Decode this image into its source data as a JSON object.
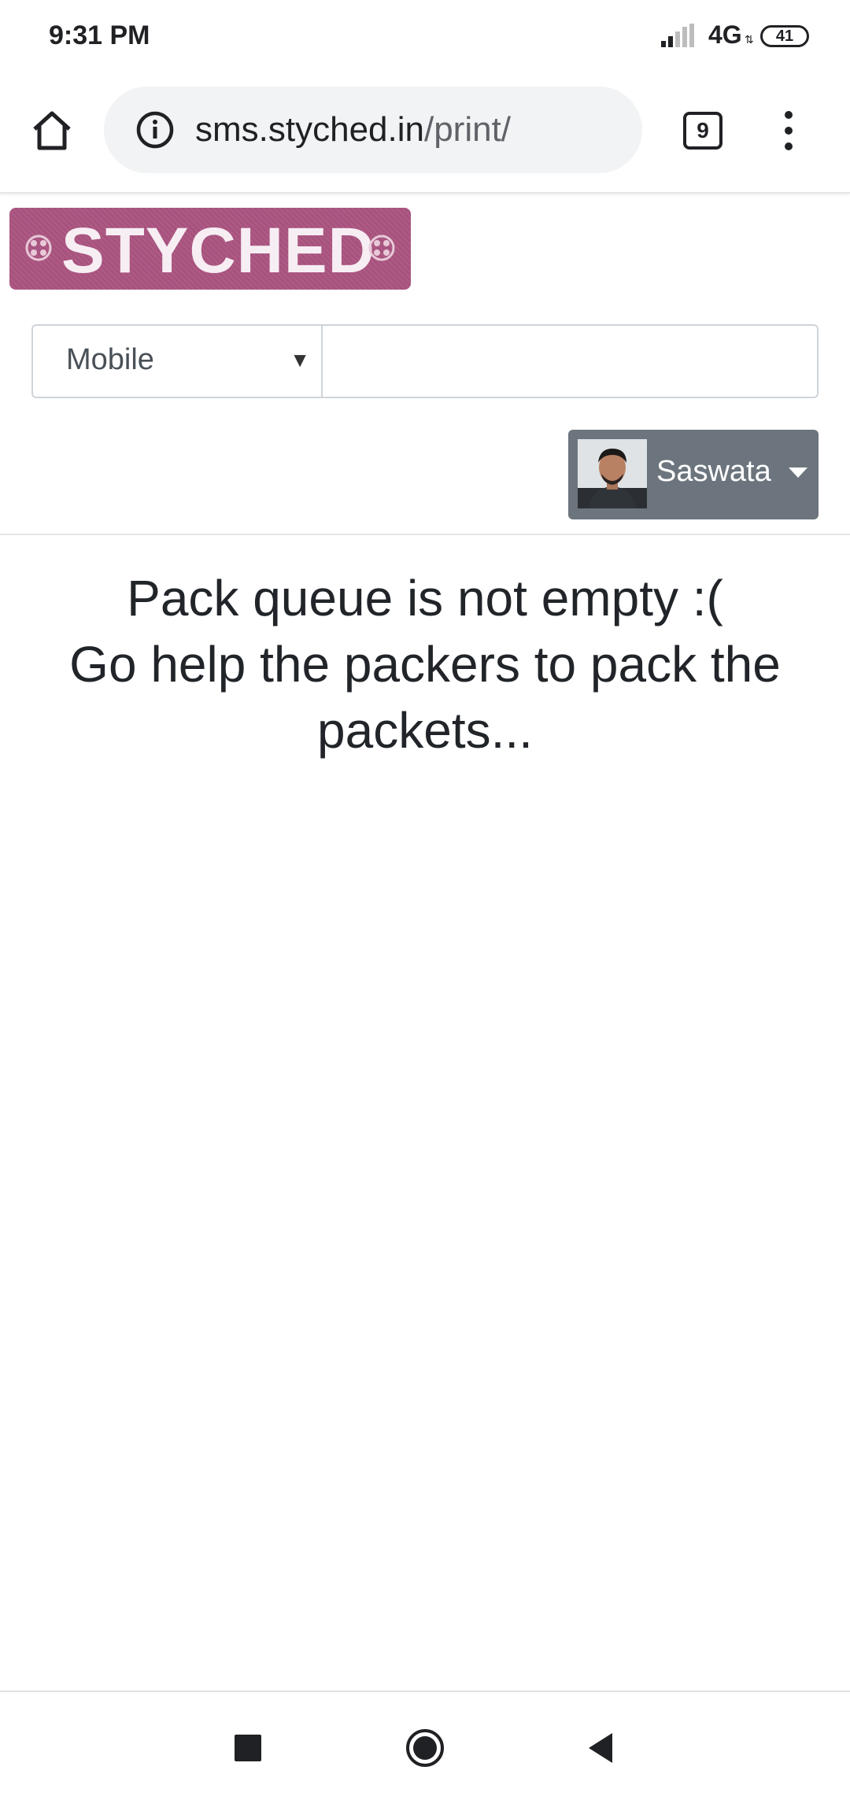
{
  "status_bar": {
    "time": "9:31 PM",
    "network": "4G",
    "battery": "41"
  },
  "browser": {
    "url_domain": "sms.styched.in",
    "url_path": "/print/",
    "tab_count": "9"
  },
  "page": {
    "logo_text": "STYCHED",
    "search_type_selected": "Mobile",
    "search_value": "",
    "user_name": "Saswata",
    "message_line1": "Pack queue is not empty :(",
    "message_line2": "Go help the packers to pack the packets..."
  },
  "colors": {
    "logo_bg": "#a8527e",
    "user_button_bg": "#6c757d"
  }
}
